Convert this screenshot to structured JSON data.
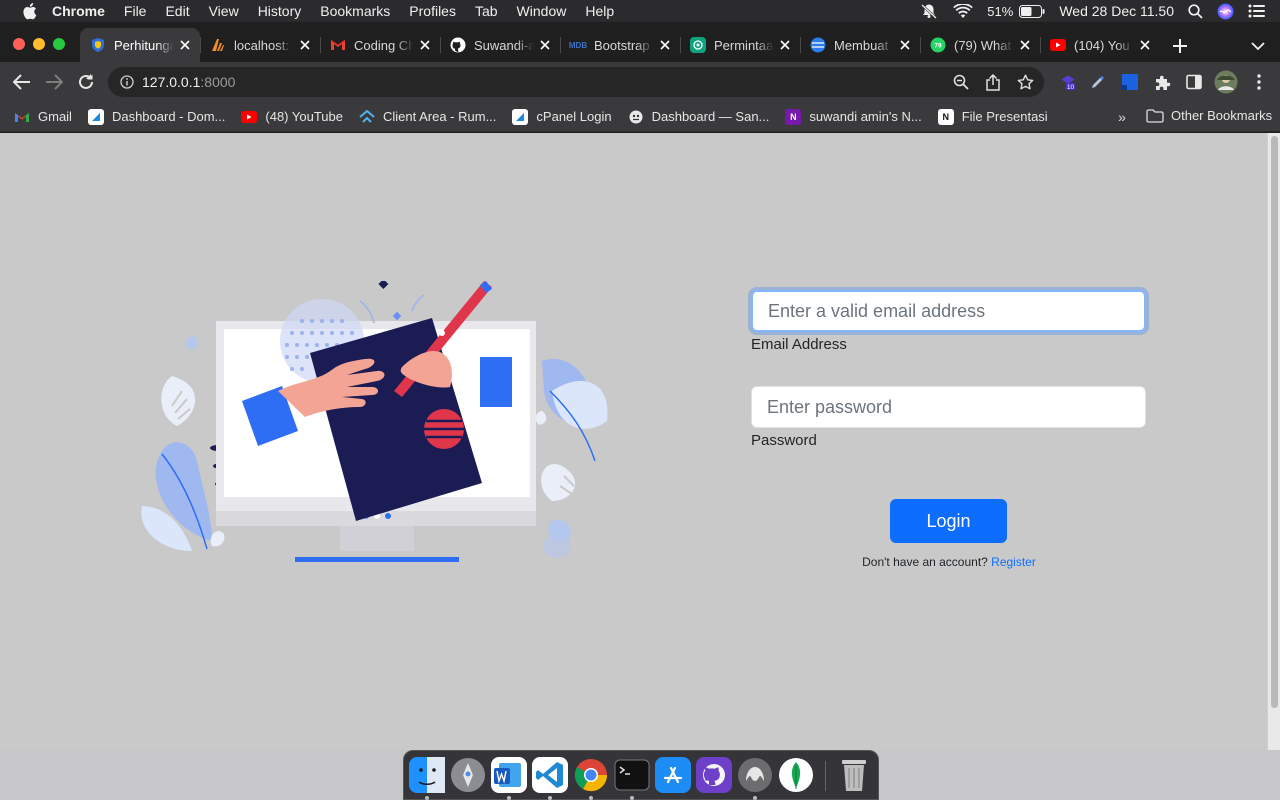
{
  "menubar": {
    "app": "Chrome",
    "items": [
      "File",
      "Edit",
      "View",
      "History",
      "Bookmarks",
      "Profiles",
      "Tab",
      "Window",
      "Help"
    ],
    "battery": "51%",
    "clock": "Wed 28 Dec  11.50"
  },
  "tabs": [
    {
      "title": "Perhitungan",
      "icon": "shield-icon",
      "color": "#2f6fd6"
    },
    {
      "title": "localhost:",
      "icon": "xampp-icon",
      "color": "#f28b2b"
    },
    {
      "title": "Coding Ch",
      "icon": "gmail-icon",
      "color": "#ea4335"
    },
    {
      "title": "Suwandi-a",
      "icon": "github-icon",
      "color": "#ffffff"
    },
    {
      "title": "Bootstrap",
      "icon": "mdb-icon",
      "color": "#3b71ca"
    },
    {
      "title": "Permintaa",
      "icon": "openai-icon",
      "color": "#10a37f"
    },
    {
      "title": "Membuat",
      "icon": "globe-icon",
      "color": "#2b7de9"
    },
    {
      "title": "(79) What",
      "icon": "whatsapp-icon",
      "color": "#25d366"
    },
    {
      "title": "(104) You",
      "icon": "youtube-icon",
      "color": "#ff0000"
    }
  ],
  "address": {
    "host": "127.0.0.1",
    "port": ":8000"
  },
  "extension_badge": "10",
  "bookmarks": [
    {
      "label": "Gmail",
      "icon": "gmail-icon"
    },
    {
      "label": "Dashboard - Dom...",
      "icon": "dashboard-icon"
    },
    {
      "label": "(48) YouTube",
      "icon": "youtube-icon"
    },
    {
      "label": "Client Area - Rum...",
      "icon": "rumahweb-icon"
    },
    {
      "label": "cPanel Login",
      "icon": "cpanel-icon"
    },
    {
      "label": "Dashboard — San...",
      "icon": "sanity-icon"
    },
    {
      "label": "suwandi amin's N...",
      "icon": "onenote-icon"
    },
    {
      "label": "File Presentasi",
      "icon": "notion-icon"
    }
  ],
  "bookmarks_more": "»",
  "other_bookmarks": "Other Bookmarks",
  "login": {
    "email_placeholder": "Enter a valid email address",
    "email_label": "Email Address",
    "password_placeholder": "Enter password",
    "password_label": "Password",
    "button": "Login",
    "no_account": "Don't have an account? ",
    "register": "Register"
  },
  "dock": [
    "Finder",
    "Launchpad",
    "Microsoft Word",
    "Visual Studio Code",
    "Google Chrome",
    "Terminal",
    "App Store",
    "GitHub Desktop",
    "TablePlus",
    "MongoDB Compass",
    "Trash"
  ],
  "colors": {
    "page_bg": "#c9c9c9",
    "primary": "#0d6efd",
    "focus_ring": "#86b7fe",
    "illustration_navy": "#1c1c55",
    "illustration_blue": "#2e6ef5",
    "illustration_red": "#e0364c"
  }
}
